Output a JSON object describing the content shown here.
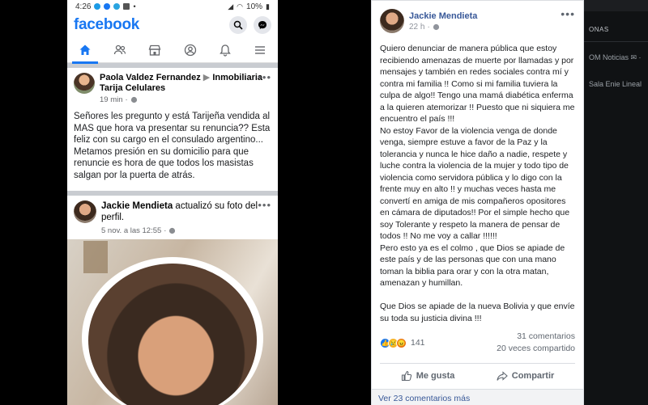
{
  "phone": {
    "status_time": "4:26",
    "status_battery": "10%",
    "app_name": "facebook",
    "post1": {
      "author": "Paola Valdez Fernandez",
      "group": "Inmobiliaria Tarija Celulares",
      "time": "19 min",
      "text": "Señores les pregunto y está Tarijeña vendida al MAS que hora va presentar su renuncia?? Esta feliz con su cargo en el consulado argentino... Metamos presión en su domicilio para que renuncie es hora de que todos los masistas salgan por la puerta de atrás."
    },
    "post2": {
      "author": "Jackie Mendieta",
      "action": "actualizó su foto del perfil.",
      "time": "5 nov. a las 12:55"
    }
  },
  "desktop_post": {
    "author": "Jackie Mendieta",
    "time": "22 h",
    "text": "Quiero denunciar de manera pública que estoy recibiendo amenazas de muerte por llamadas y por mensajes y también en redes sociales contra mí y contra mi familia !! Como si mi familia tuviera la culpa de algo!! Tengo una mamá diabética enferma a la quieren atemorizar !! Puesto que ni siquiera me encuentro el país !!!\nNo estoy Favor de la violencia venga de donde venga, siempre estuve a favor de la Paz y la tolerancia y nunca le hice daño a nadie, respete y luche contra la violencia de la mujer y todo tipo de violencia como servidora pública y lo digo con la frente muy en alto !! y muchas veces hasta me convertí en amiga de mis compañeros opositores en cámara de diputados!! Por el simple hecho que soy Tolerante y respeto la manera de pensar de todos !! No me voy a callar !!!!!!\nPero esto ya es el colmo , que Dios se apiade de este país y de las personas que con una mano toman la biblia para orar y con la otra matan, amenazan y humillan.\n\nQue Dios se apiade de la nueva Bolivia y que envíe su toda su justicia divina !!!",
    "reactions_count": "141",
    "comments": "31 comentarios",
    "shares": "20 veces compartido",
    "like_label": "Me gusta",
    "share_label": "Compartir",
    "more_comments": "Ver 23 comentarios más"
  },
  "sidebar": {
    "tag": "ONAS",
    "items": [
      "OM Noticias ✉ ·",
      "Sala Enie Lineal"
    ]
  },
  "colors": {
    "fb_blue": "#1877f2",
    "link_blue": "#385898"
  }
}
